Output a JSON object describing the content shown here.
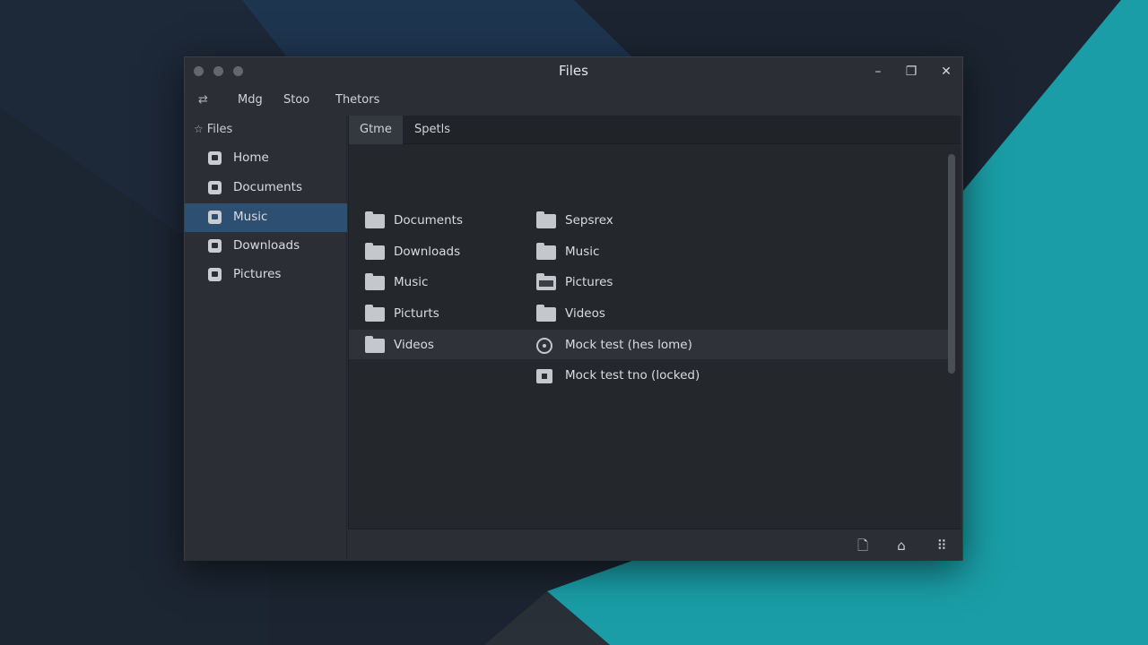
{
  "window": {
    "title": "Files",
    "controls": {
      "minimize": "–",
      "maximize": "❐",
      "close": "✕"
    }
  },
  "menubar": {
    "items": [
      "Mdg",
      "Stoo",
      "Thetors"
    ],
    "back_icon": "⇄"
  },
  "sidebar": {
    "header": "Files",
    "header_icon": "☆",
    "items": [
      {
        "label": "Home",
        "icon": "chat-bubble-icon",
        "selected": false
      },
      {
        "label": "Documents",
        "icon": "home-icon",
        "selected": false
      },
      {
        "label": "Music",
        "icon": "file-icon",
        "selected": true
      },
      {
        "label": "Downloads",
        "icon": "file-icon",
        "selected": false
      },
      {
        "label": "Pictures",
        "icon": "file-icon",
        "selected": false
      }
    ]
  },
  "tabs": [
    {
      "label": "Gtme",
      "active": true
    },
    {
      "label": "Spetls",
      "active": false
    }
  ],
  "files": {
    "left_column": [
      {
        "label": "Documents",
        "icon": "folder-icon"
      },
      {
        "label": "Downloads",
        "icon": "folder-icon"
      },
      {
        "label": "Music",
        "icon": "folder-icon"
      },
      {
        "label": "Picturts",
        "icon": "folder-icon"
      },
      {
        "label": "Videos",
        "icon": "folder-icon"
      }
    ],
    "right_column": [
      {
        "label": "Sepsrex",
        "icon": "folder-icon"
      },
      {
        "label": "Music",
        "icon": "folder-icon"
      },
      {
        "label": "Pictures",
        "icon": "folder-dark-icon"
      },
      {
        "label": "Videos",
        "icon": "folder-icon"
      },
      {
        "label": "Mock test (hes lome)",
        "icon": "disc-icon"
      },
      {
        "label": "Mock test tno (locked)",
        "icon": "lock-file-icon"
      }
    ],
    "highlighted_row_index": 4
  },
  "statusbar": {
    "buttons": [
      {
        "name": "new-file-button",
        "glyph": "🗋",
        "icon": "file-icon"
      },
      {
        "name": "trash-button",
        "glyph": "⌂",
        "icon": "trash-icon"
      },
      {
        "name": "grid-view-button",
        "glyph": "⠿",
        "icon": "grid-icon"
      }
    ]
  },
  "colors": {
    "accent_selected": "#2c4f72",
    "wallpaper_teal": "#1a9da6",
    "wallpaper_blue": "#1e3c5c"
  }
}
